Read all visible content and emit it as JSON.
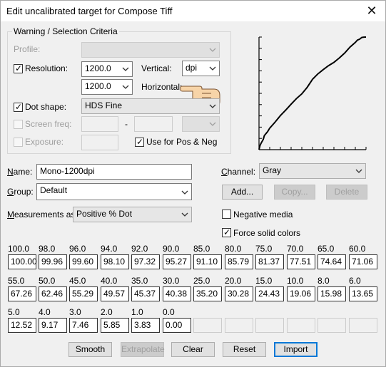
{
  "window": {
    "title": "Edit uncalibrated target for Compose Tiff"
  },
  "criteria": {
    "group_label": "Warning / Selection Criteria",
    "profile_label": "Profile:",
    "resolution_label": "Resolution:",
    "resolution_checked": true,
    "resolution_value_1": "1200.0",
    "resolution_value_2": "1200.0",
    "vertical_label": "Vertical:",
    "horizontal_label": "Horizontal:",
    "unit_value": "dpi",
    "dot_shape_label": "Dot shape:",
    "dot_shape_checked": true,
    "dot_shape_value": "HDS Fine",
    "screen_freq_label": "Screen freq:",
    "screen_freq_dash": "-",
    "exposure_label": "Exposure:",
    "use_pos_neg_label": "Use for Pos & Neg",
    "use_pos_neg_checked": true
  },
  "form": {
    "name_label": "Name:",
    "name_value": "Mono-1200dpi",
    "group_label": "Group:",
    "group_value": "Default",
    "measurements_label": "Measurements as:",
    "measurements_value": "Positive % Dot",
    "channel_label": "Channel:",
    "channel_value": "Gray",
    "add_button": "Add...",
    "copy_button": "Copy...",
    "delete_button": "Delete",
    "negative_media_label": "Negative media",
    "negative_media_checked": false,
    "force_solid_label": "Force solid colors",
    "force_solid_checked": true
  },
  "table": {
    "rows": [
      {
        "headers": [
          "100.0",
          "98.0",
          "96.0",
          "94.0",
          "92.0",
          "90.0",
          "85.0",
          "80.0",
          "75.0",
          "70.0",
          "65.0",
          "60.0"
        ],
        "values": [
          "100.00",
          "99.96",
          "99.60",
          "98.10",
          "97.32",
          "95.27",
          "91.10",
          "85.79",
          "81.37",
          "77.51",
          "74.64",
          "71.06"
        ]
      },
      {
        "headers": [
          "55.0",
          "50.0",
          "45.0",
          "40.0",
          "35.0",
          "30.0",
          "25.0",
          "20.0",
          "15.0",
          "10.0",
          "8.0",
          "6.0"
        ],
        "values": [
          "67.26",
          "62.46",
          "55.29",
          "49.57",
          "45.37",
          "40.38",
          "35.20",
          "30.28",
          "24.43",
          "19.06",
          "15.98",
          "13.65"
        ]
      },
      {
        "headers": [
          "5.0",
          "4.0",
          "3.0",
          "2.0",
          "1.0",
          "0.0",
          "",
          "",
          "",
          "",
          "",
          ""
        ],
        "values": [
          "12.52",
          "9.17",
          "7.46",
          "5.85",
          "3.83",
          "0.00",
          "",
          "",
          "",
          "",
          "",
          ""
        ]
      }
    ]
  },
  "buttons": {
    "smooth": "Smooth",
    "extrapolate": "Extrapolate",
    "clear": "Clear",
    "reset": "Reset",
    "import": "Import"
  },
  "chart_data": {
    "type": "line",
    "title": "",
    "xlabel": "",
    "ylabel": "",
    "x": [
      0,
      1,
      2,
      3,
      4,
      5,
      6,
      8,
      10,
      15,
      20,
      25,
      30,
      35,
      40,
      45,
      50,
      55,
      60,
      65,
      70,
      75,
      80,
      85,
      90,
      92,
      94,
      96,
      98,
      100
    ],
    "y": [
      0.0,
      3.83,
      5.85,
      7.46,
      9.17,
      12.52,
      13.65,
      15.98,
      19.06,
      24.43,
      30.28,
      35.2,
      40.38,
      45.37,
      49.57,
      55.29,
      62.46,
      67.26,
      71.06,
      74.64,
      77.51,
      81.37,
      85.79,
      91.1,
      95.27,
      97.32,
      98.1,
      99.6,
      99.96,
      100.0
    ],
    "xlim": [
      0,
      100
    ],
    "ylim": [
      0,
      100
    ],
    "grid": false
  },
  "colors": {
    "accent": "#0078d7",
    "window_bg": "#f0f0f0"
  }
}
